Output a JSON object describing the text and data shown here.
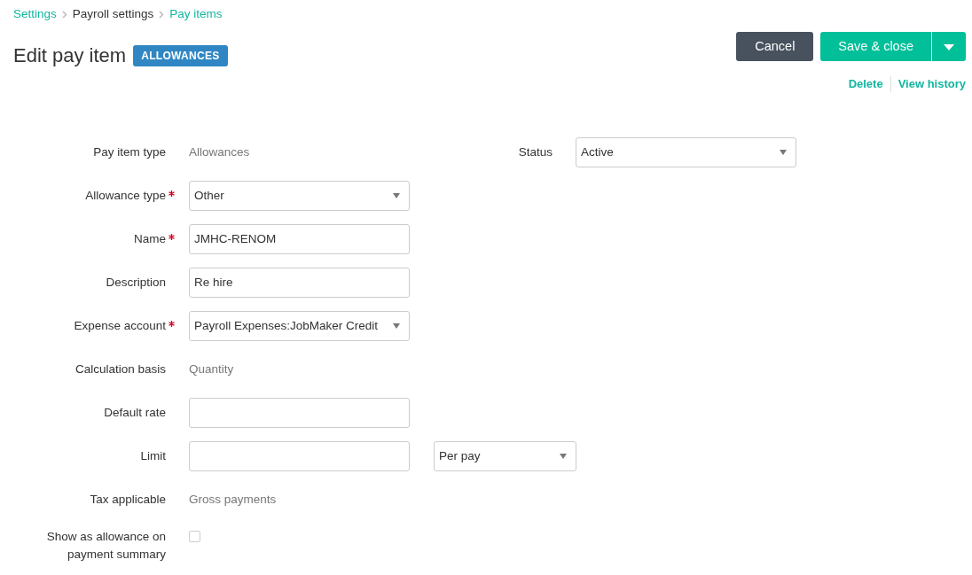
{
  "breadcrumb": [
    {
      "label": "Settings",
      "link": true
    },
    {
      "label": "Payroll settings",
      "link": false
    },
    {
      "label": "Pay items",
      "link": true
    }
  ],
  "title": "Edit pay item",
  "badge": "ALLOWANCES",
  "actions": {
    "cancel": "Cancel",
    "save": "Save & close",
    "links": [
      "Delete",
      "View history"
    ]
  },
  "status": {
    "label": "Status",
    "value": "Active"
  },
  "fields": [
    {
      "kind": "static",
      "label": "Pay item type",
      "required": false,
      "value": "Allowances"
    },
    {
      "kind": "select",
      "label": "Allowance type",
      "required": true,
      "value": "Other"
    },
    {
      "kind": "text",
      "label": "Name",
      "required": true,
      "value": "JMHC-RENOM"
    },
    {
      "kind": "text",
      "label": "Description",
      "required": false,
      "value": "Re hire"
    },
    {
      "kind": "select",
      "label": "Expense account",
      "required": true,
      "value": "Payroll Expenses:JobMaker Credit"
    },
    {
      "kind": "static",
      "label": "Calculation basis",
      "required": false,
      "value": "Quantity"
    },
    {
      "kind": "text",
      "label": "Default rate",
      "required": false
    },
    {
      "kind": "text",
      "label": "Limit",
      "required": false,
      "extra_select": "Per pay"
    },
    {
      "kind": "static",
      "label": "Tax applicable",
      "required": false,
      "value": "Gross payments"
    },
    {
      "kind": "checkbox",
      "label": "Show as allowance on payment summary",
      "required": false,
      "checked": false
    }
  ]
}
